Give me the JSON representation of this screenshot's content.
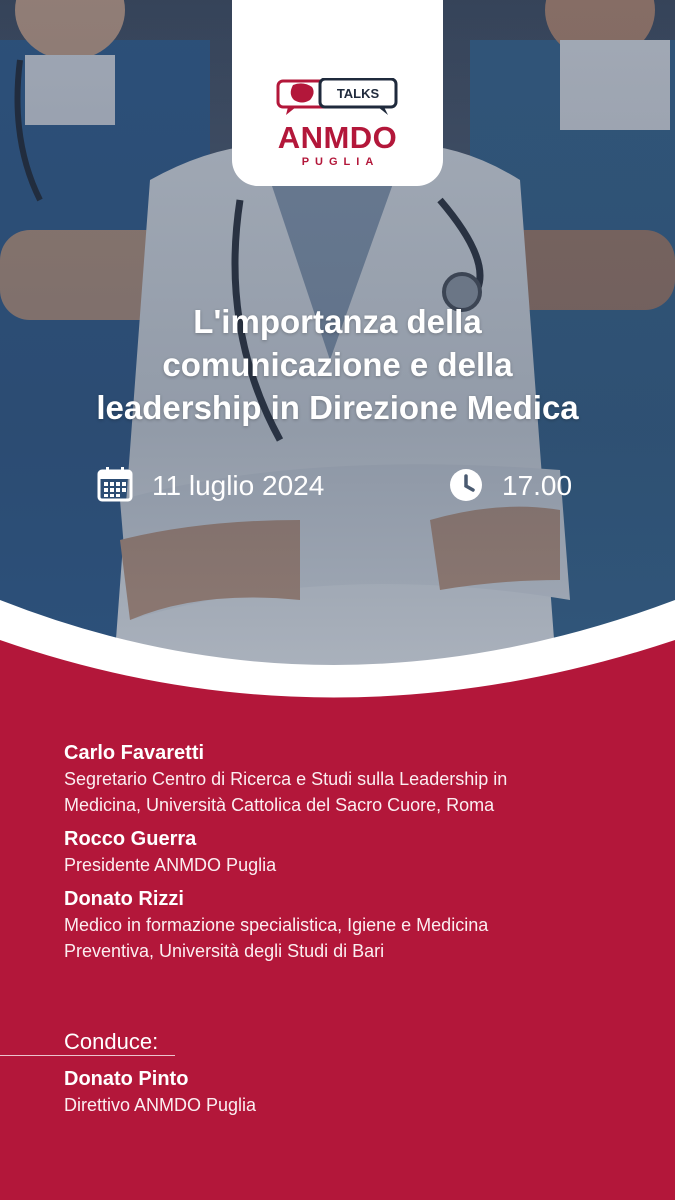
{
  "logo": {
    "talks": "TALKS",
    "title": "ANMDO",
    "subtitle": "PUGLIA",
    "colors": {
      "brand": "#b3173a",
      "dark": "#1f2a3c"
    }
  },
  "event": {
    "title": "L'importanza della comunicazione e della leadership in Direzione Medica",
    "title_lines": [
      "L'importanza della",
      "comunicazione e della",
      "leadership in Direzione Medica"
    ],
    "date": "11 luglio 2024",
    "time": "17.00",
    "date_icon": "calendar-icon",
    "time_icon": "clock-icon"
  },
  "speakers": [
    {
      "name": "Carlo Favaretti",
      "role_lines": [
        "Segretario Centro di Ricerca e Studi sulla Leadership in",
        "Medicina, Università Cattolica del Sacro Cuore, Roma"
      ]
    },
    {
      "name": "Rocco Guerra",
      "role_lines": [
        "Presidente ANMDO Puglia"
      ]
    },
    {
      "name": "Donato Rizzi",
      "role_lines": [
        "Medico in formazione specialistica, Igiene e Medicina",
        "Preventiva, Università degli Studi di Bari"
      ]
    }
  ],
  "conduce": {
    "label": "Conduce:",
    "name": "Donato Pinto",
    "role": "Direttivo ANMDO Puglia"
  },
  "colors": {
    "panel": "#b3173a",
    "text": "#ffffff"
  }
}
